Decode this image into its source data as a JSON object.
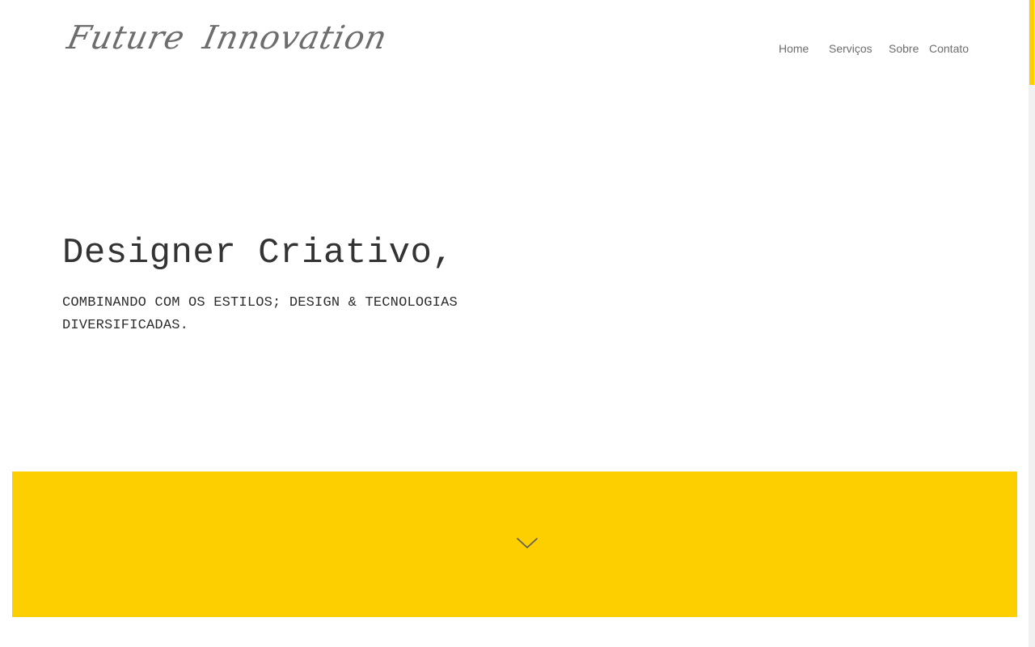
{
  "brand": {
    "logo_text": "Future Innovation"
  },
  "nav": {
    "items": [
      {
        "label": "Home"
      },
      {
        "label": "Serviços"
      },
      {
        "label": "Sobre"
      },
      {
        "label": "Contato"
      }
    ]
  },
  "hero": {
    "title": "Designer Criativo,",
    "subtitle": "COMBINANDO COM OS ESTILOS; DESIGN & TECNOLOGIAS DIVERSIFICADAS."
  },
  "icons": {
    "scroll_down": "chevron-down-icon"
  },
  "colors": {
    "accent": "#fdcf00",
    "text_dark": "#333333",
    "text_muted": "#6e6e6e",
    "background": "#ffffff"
  }
}
